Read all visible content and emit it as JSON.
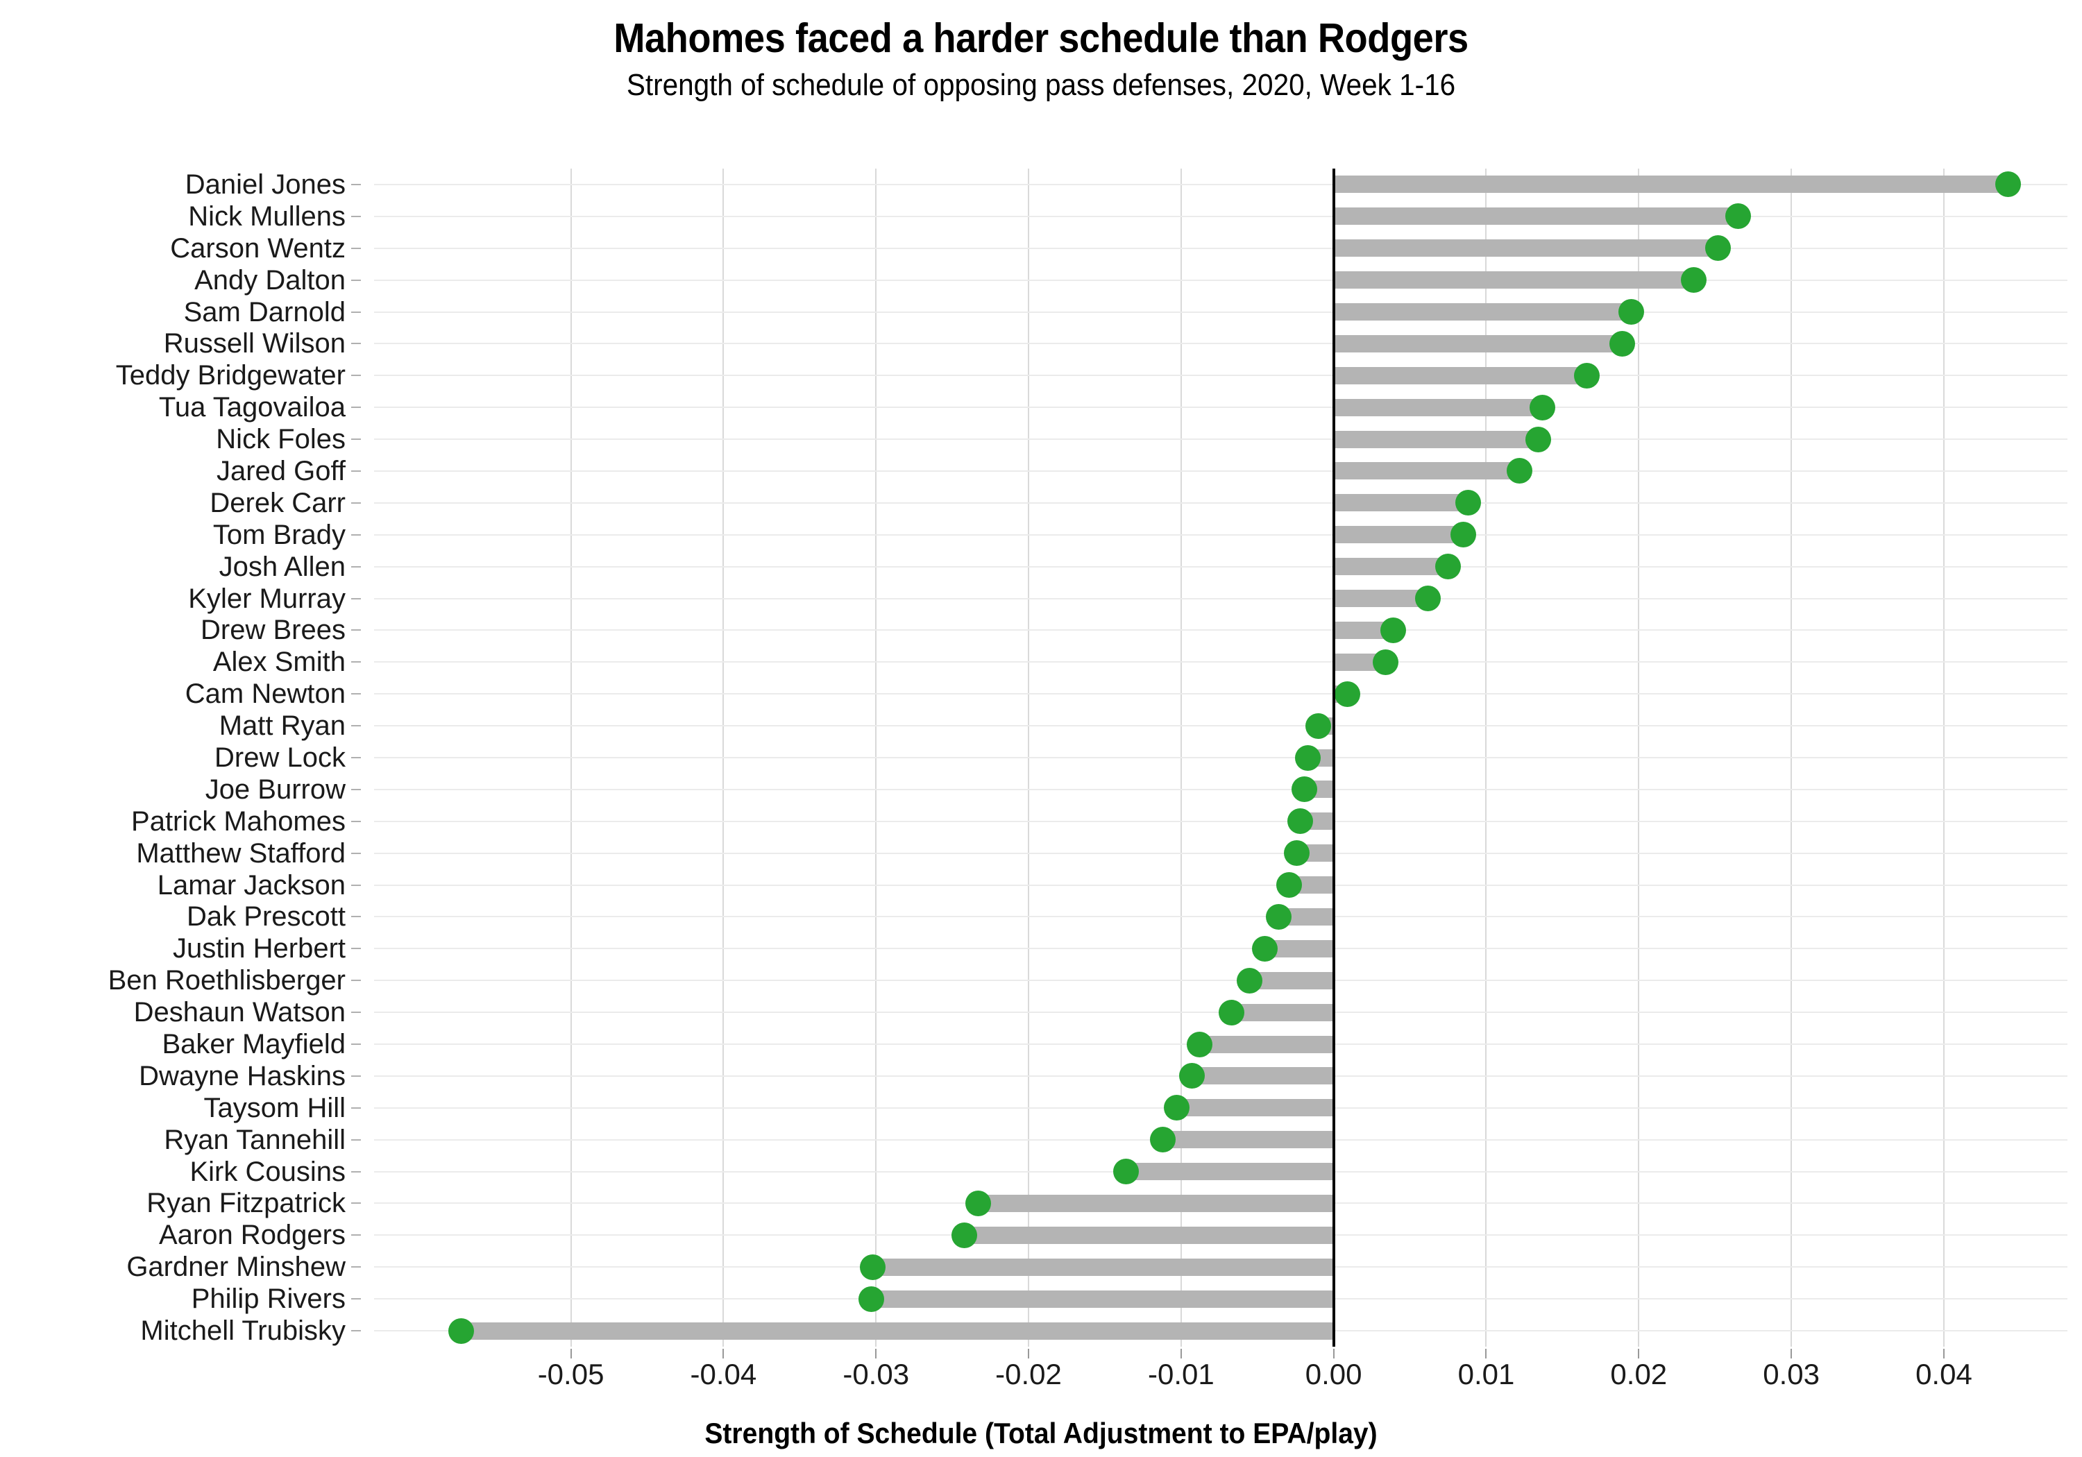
{
  "chart_data": {
    "type": "bar",
    "subtype": "lollipop-horizontal",
    "title": "Mahomes faced a harder schedule than Rodgers",
    "subtitle": "Strength of schedule of opposing pass defenses, 2020, Week 1-16",
    "xlabel": "Strength of Schedule (Total Adjustment to EPA/play)",
    "ylabel": "",
    "xlim": [
      -0.0629,
      0.0481
    ],
    "xticks": [
      -0.05,
      -0.04,
      -0.03,
      -0.02,
      -0.01,
      0.0,
      0.01,
      0.02,
      0.03,
      0.04
    ],
    "xtick_labels": [
      "-0.05",
      "-0.04",
      "-0.03",
      "-0.02",
      "-0.01",
      "0.00",
      "0.01",
      "0.02",
      "0.03",
      "0.04"
    ],
    "grid": true,
    "legend": false,
    "orientation": "horizontal",
    "zero_reference_line": 0.0,
    "colors": {
      "dot": "#26a532",
      "stem": "#b4b4b4",
      "gridline": "#d9d9d9",
      "zero_line": "#000000",
      "background": "#ffffff",
      "text": "#1a1a1a"
    },
    "categories": [
      "Daniel Jones",
      "Nick Mullens",
      "Carson Wentz",
      "Andy Dalton",
      "Sam Darnold",
      "Russell Wilson",
      "Teddy Bridgewater",
      "Tua Tagovailoa",
      "Nick Foles",
      "Jared Goff",
      "Derek Carr",
      "Tom Brady",
      "Josh Allen",
      "Kyler Murray",
      "Drew Brees",
      "Alex Smith",
      "Cam Newton",
      "Matt Ryan",
      "Drew Lock",
      "Joe Burrow",
      "Patrick Mahomes",
      "Matthew Stafford",
      "Lamar Jackson",
      "Dak Prescott",
      "Justin Herbert",
      "Ben Roethlisberger",
      "Deshaun Watson",
      "Baker Mayfield",
      "Dwayne Haskins",
      "Taysom Hill",
      "Ryan Tannehill",
      "Kirk Cousins",
      "Ryan Fitzpatrick",
      "Aaron Rodgers",
      "Gardner Minshew",
      "Philip Rivers",
      "Mitchell Trubisky"
    ],
    "values": [
      0.0442,
      0.0265,
      0.0252,
      0.0236,
      0.0195,
      0.0189,
      0.0166,
      0.0137,
      0.0134,
      0.0122,
      0.0088,
      0.0085,
      0.0075,
      0.0062,
      0.0039,
      0.0034,
      0.0009,
      -0.001,
      -0.0017,
      -0.0019,
      -0.0022,
      -0.0024,
      -0.0029,
      -0.0036,
      -0.0045,
      -0.0055,
      -0.0067,
      -0.0088,
      -0.0093,
      -0.0103,
      -0.0112,
      -0.0136,
      -0.0233,
      -0.0242,
      -0.0302,
      -0.0303,
      -0.0572
    ]
  }
}
